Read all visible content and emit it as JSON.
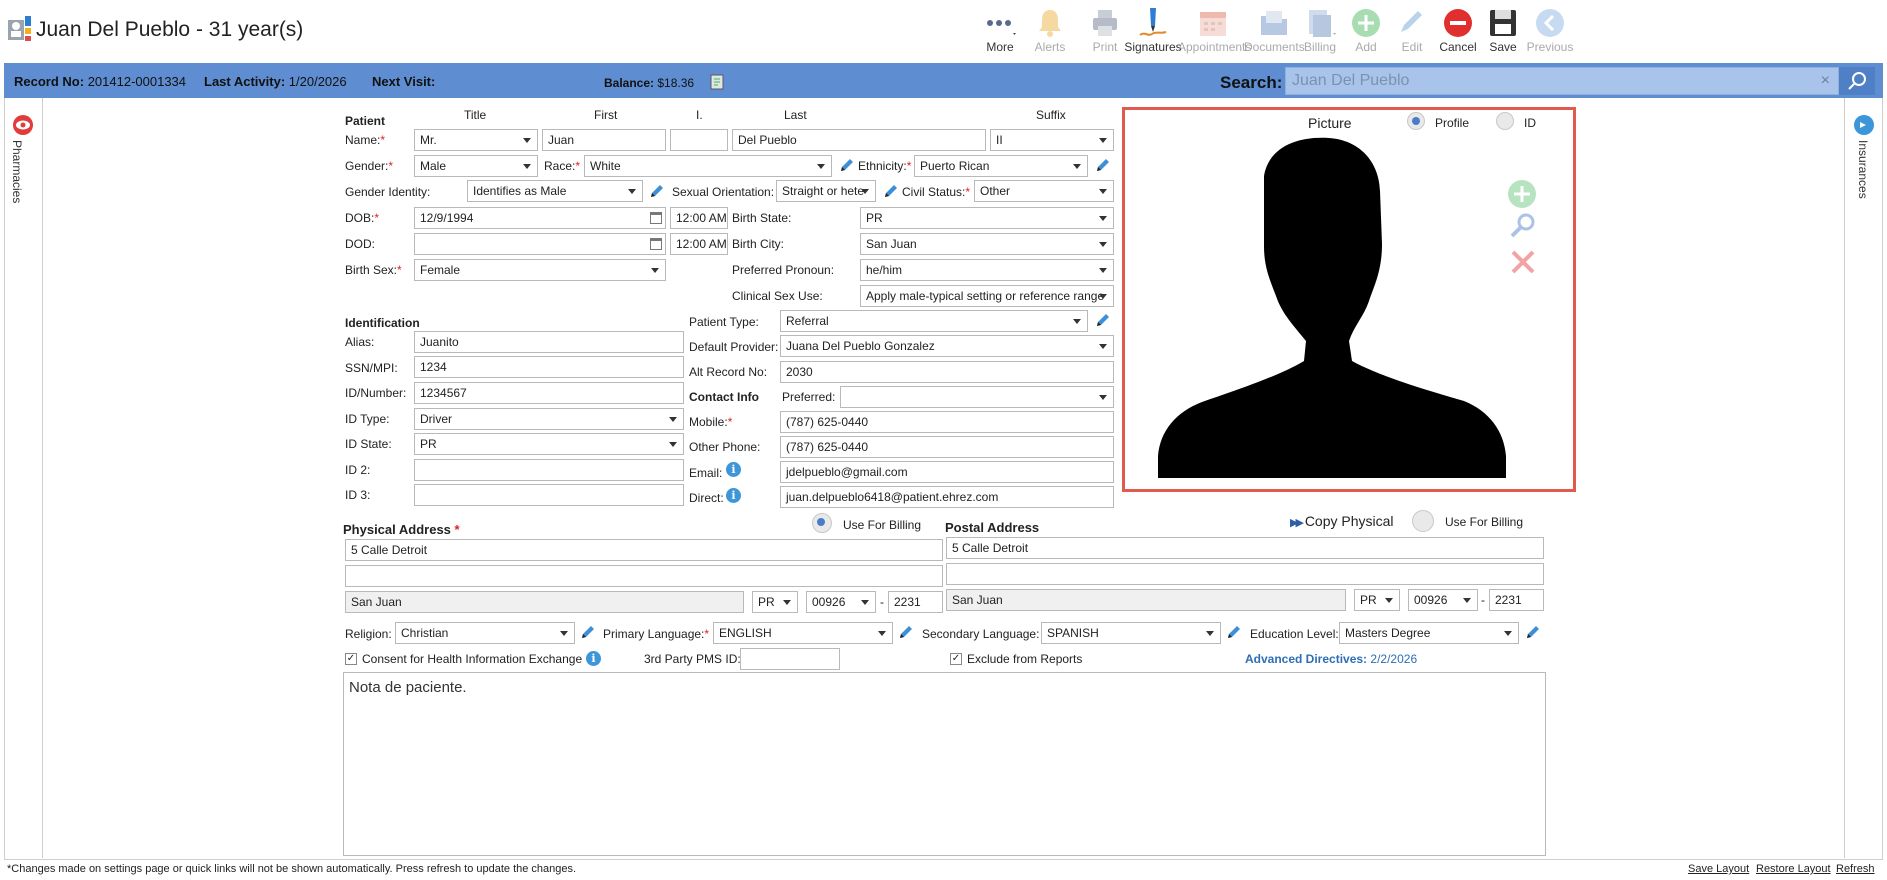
{
  "window": {
    "title": "Juan Del Pueblo - 31 year(s)"
  },
  "toolbar": {
    "more": "More",
    "alerts": "Alerts",
    "print": "Print",
    "signatures": "Signatures",
    "appointments": "Appointments",
    "documents": "Documents",
    "billing": "Billing",
    "add": "Add",
    "edit": "Edit",
    "cancel": "Cancel",
    "save": "Save",
    "previous": "Previous"
  },
  "infobar": {
    "record_label": "Record No:",
    "record_value": "201412-0001334",
    "activity_label": "Last Activity:",
    "activity_value": "1/20/2026",
    "next_visit_label": "Next Visit:",
    "balance_label": "Balance:",
    "balance_value": "$18.36",
    "search_label": "Search:",
    "search_value": "Juan Del Pueblo",
    "search_clear": "×"
  },
  "side": {
    "left": "Pharmacies",
    "right": "Insurances"
  },
  "patient": {
    "section": "Patient",
    "col_title": "Title",
    "col_first": "First",
    "col_i": "I.",
    "col_last": "Last",
    "col_suffix": "Suffix",
    "name_label": "Name:",
    "title": "Mr.",
    "first": "Juan",
    "initial": "",
    "last": "Del Pueblo",
    "suffix": "II",
    "gender_label": "Gender:",
    "gender": "Male",
    "race_label": "Race:",
    "race": "White",
    "ethnicity_label": "Ethnicity:",
    "ethnicity": "Puerto Rican",
    "gender_identity_label": "Gender Identity:",
    "gender_identity": "Identifies as Male",
    "sexual_orientation_label": "Sexual Orientation:",
    "sexual_orientation": "Straight or hete",
    "civil_status_label": "Civil Status:",
    "civil_status": "Other",
    "dob_label": "DOB:",
    "dob": "12/9/1994",
    "dob_time": "12:00 AM",
    "birth_state_label": "Birth State:",
    "birth_state": "PR",
    "dod_label": "DOD:",
    "dod": "",
    "dod_time": "12:00 AM",
    "birth_city_label": "Birth City:",
    "birth_city": "San Juan",
    "birth_sex_label": "Birth Sex:",
    "birth_sex": "Female",
    "pronoun_label": "Preferred Pronoun:",
    "pronoun": "he/him",
    "clinical_sex_label": "Clinical Sex Use:",
    "clinical_sex": "Apply male-typical setting or reference range"
  },
  "identification": {
    "section": "Identification",
    "alias_label": "Alias:",
    "alias": "Juanito",
    "ssn_label": "SSN/MPI:",
    "ssn": "1234",
    "idnum_label": "ID/Number:",
    "idnum": "1234567",
    "idtype_label": "ID Type:",
    "idtype": "Driver",
    "idstate_label": "ID State:",
    "idstate": "PR",
    "id2_label": "ID 2:",
    "id2": "",
    "id3_label": "ID 3:",
    "id3": "",
    "patient_type_label": "Patient Type:",
    "patient_type": "Referral",
    "provider_label": "Default Provider:",
    "provider": "Juana Del Pueblo Gonzalez",
    "alt_record_label": "Alt Record No:",
    "alt_record": "2030"
  },
  "contact": {
    "section": "Contact Info",
    "preferred_label": "Preferred:",
    "preferred": "",
    "mobile_label": "Mobile:",
    "mobile": "(787) 625-0440",
    "other_phone_label": "Other Phone:",
    "other_phone": "(787) 625-0440",
    "email_label": "Email:",
    "email": "jdelpueblo@gmail.com",
    "direct_label": "Direct:",
    "direct": "juan.delpueblo6418@patient.ehrez.com"
  },
  "picture": {
    "label": "Picture",
    "profile": "Profile",
    "id": "ID"
  },
  "physical": {
    "section": "Physical Address",
    "req": "*",
    "use_billing": "Use For Billing",
    "line1": "5 Calle Detroit",
    "line2": "",
    "city": "San Juan",
    "state": "PR",
    "zip": "00926",
    "zip4": "2231",
    "dash": "-"
  },
  "postal": {
    "section": "Postal Address",
    "copy": "Copy Physical",
    "use_billing": "Use For Billing",
    "line1": "5 Calle Detroit",
    "line2": "",
    "city": "San Juan",
    "state": "PR",
    "zip": "00926",
    "zip4": "2231",
    "dash": "-"
  },
  "misc": {
    "religion_label": "Religion:",
    "religion": "Christian",
    "primary_lang_label": "Primary Language:",
    "primary_lang": "ENGLISH",
    "secondary_lang_label": "Secondary Language:",
    "secondary_lang": "SPANISH",
    "education_label": "Education Level:",
    "education": "Masters Degree",
    "consent_label": "Consent for Health Information Exchange",
    "pms_label": "3rd Party PMS ID:",
    "pms": "",
    "exclude_label": "Exclude from Reports",
    "adv_label": "Advanced Directives:",
    "adv_value": "2/2/2026",
    "check": "✓",
    "notes": "Nota de paciente."
  },
  "footer": {
    "note": "*Changes made on settings page or quick links will not be shown automatically. Press refresh to update the changes.",
    "save_layout": "Save Layout",
    "restore_layout": "Restore Layout",
    "refresh": "Refresh"
  },
  "colors": {
    "infobar": "#5e8ed1",
    "highlight": "#e05a4e",
    "accent": "#4a7cc9"
  }
}
